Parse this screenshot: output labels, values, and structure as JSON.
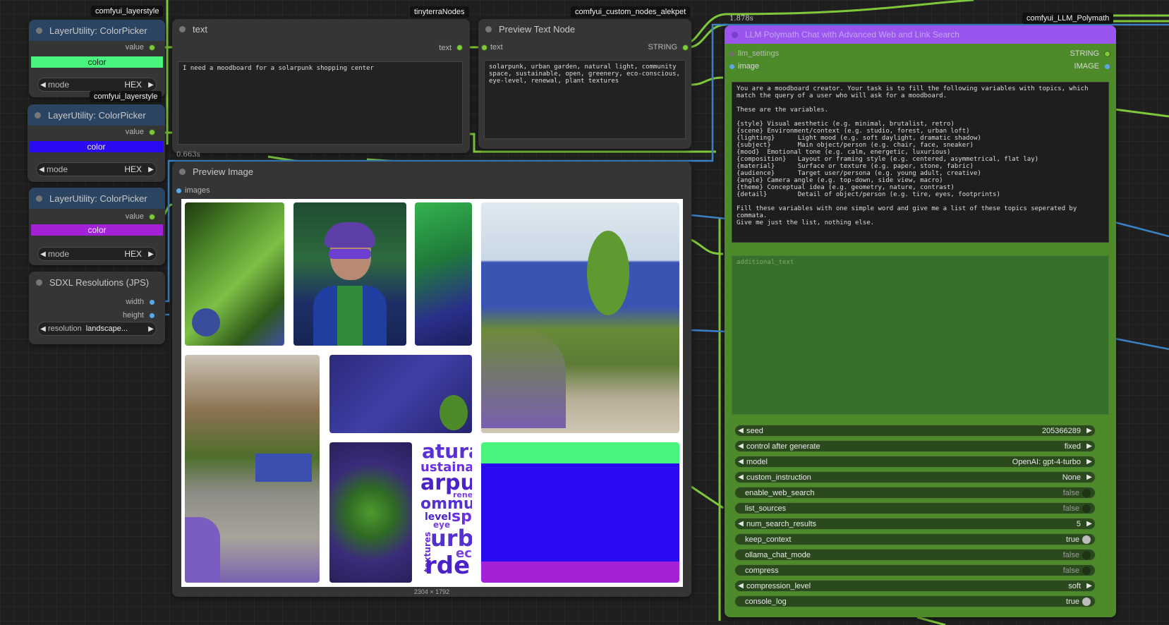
{
  "tags": {
    "layerstyle_1": "comfyui_layerstyle",
    "layerstyle_2": "comfyui_layerstyle",
    "tinyterra": "tinyterraNodes",
    "alekpet": "comfyui_custom_nodes_alekpet",
    "polymath": "comfyui_LLM_Polymath"
  },
  "timings": {
    "polymath": "1.878s",
    "text": "0.663s"
  },
  "color_pickers": [
    {
      "title": "LayerUtility: ColorPicker",
      "out_label": "value",
      "swatch_label": "color",
      "swatch_color": "#49f57f",
      "mode_label": "mode",
      "mode_value": "HEX"
    },
    {
      "title": "LayerUtility: ColorPicker",
      "out_label": "value",
      "swatch_label": "color",
      "swatch_color": "#2a0af0",
      "mode_label": "mode",
      "mode_value": "HEX"
    },
    {
      "title": "LayerUtility: ColorPicker",
      "out_label": "value",
      "swatch_label": "color",
      "swatch_color": "#a321d6",
      "mode_label": "mode",
      "mode_value": "HEX"
    }
  ],
  "sdxl": {
    "title": "SDXL Resolutions (JPS)",
    "out1": "width",
    "out2": "height",
    "res_label": "resolution",
    "res_value": "landscape..."
  },
  "text_node": {
    "title": "text",
    "out_label": "text",
    "value": "I need a moodboard for a solarpunk shopping center"
  },
  "preview_text": {
    "title": "Preview Text Node",
    "in_label": "text",
    "out_label": "STRING",
    "value": "solarpunk, urban garden, natural light, community space, sustainable, open, greenery, eco-conscious, eye-level, renewal, plant textures"
  },
  "preview_image": {
    "title": "Preview Image",
    "in_label": "images",
    "size_label": "2304 × 1792"
  },
  "moodboard_words": [
    "atura",
    "ustaina",
    "arpu",
    "rene",
    "ommu",
    "sp",
    "level",
    "eye",
    "urb",
    "textures",
    "ec",
    "rder"
  ],
  "polymath": {
    "title": "LLM Polymath Chat with Advanced Web and Link Search",
    "in1": "llm_settings",
    "in2": "image",
    "out1": "STRING",
    "out2": "IMAGE",
    "prompt": "You are a moodboard creator. Your task is to fill the following variables with topics, which match the query of a user who will ask for a moodboard.\n\nThese are the variables.\n\n{style} Visual aesthetic (e.g. minimal, brutalist, retro)\n{scene} Environment/context (e.g. studio, forest, urban loft)\n{lighting}      Light mood (e.g. soft daylight, dramatic shadow)\n{subject}       Main object/person (e.g. chair, face, sneaker)\n{mood}  Emotional tone (e.g. calm, energetic, luxurious)\n{composition}   Layout or framing style (e.g. centered, asymmetrical, flat lay)\n{material}      Surface or texture (e.g. paper, stone, fabric)\n{audience}      Target user/persona (e.g. young adult, creative)\n{angle} Camera angle (e.g. top-down, side view, macro)\n{theme} Conceptual idea (e.g. geometry, nature, contrast)\n{detail}        Detail of object/person (e.g. tire, eyes, footprints)\n\nFill these variables with one simple word and give me a list of these topics seperated by commata.\nGive me just the list, nothing else.",
    "additional_placeholder": "additional_text",
    "widgets": [
      {
        "name": "seed",
        "label": "seed",
        "value": "205366289",
        "kind": "arrows"
      },
      {
        "name": "control-after-generate",
        "label": "control after generate",
        "value": "fixed",
        "kind": "arrows"
      },
      {
        "name": "model",
        "label": "model",
        "value": "OpenAI: gpt-4-turbo",
        "kind": "arrows"
      },
      {
        "name": "custom-instruction",
        "label": "custom_instruction",
        "value": "None",
        "kind": "arrows"
      },
      {
        "name": "enable-web-search",
        "label": "enable_web_search",
        "value": "false",
        "kind": "toggle-off"
      },
      {
        "name": "list-sources",
        "label": "list_sources",
        "value": "false",
        "kind": "toggle-off"
      },
      {
        "name": "num-search-results",
        "label": "num_search_results",
        "value": "5",
        "kind": "arrows"
      },
      {
        "name": "keep-context",
        "label": "keep_context",
        "value": "true",
        "kind": "toggle-on"
      },
      {
        "name": "ollama-chat-mode",
        "label": "ollama_chat_mode",
        "value": "false",
        "kind": "toggle-off"
      },
      {
        "name": "compress",
        "label": "compress",
        "value": "false",
        "kind": "toggle-off"
      },
      {
        "name": "compression-level",
        "label": "compression_level",
        "value": "soft",
        "kind": "arrows"
      },
      {
        "name": "console-log",
        "label": "console_log",
        "value": "true",
        "kind": "toggle-on"
      }
    ]
  }
}
